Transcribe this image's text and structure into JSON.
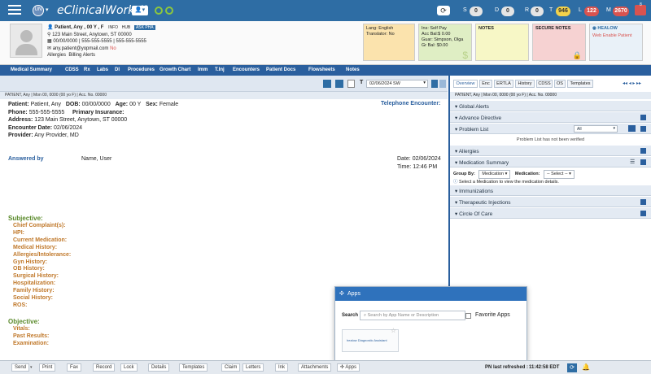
{
  "topbar": {
    "initials": "UN",
    "product": "eClinicalWorks",
    "version": "12",
    "counters": [
      {
        "letter": "S",
        "count": "0"
      },
      {
        "letter": "D",
        "count": "0"
      },
      {
        "letter": "R",
        "count": "0"
      },
      {
        "letter": "T",
        "count": "946"
      },
      {
        "letter": "L",
        "count": "122"
      },
      {
        "letter": "M",
        "count": "2670"
      }
    ],
    "corner_badge": "8"
  },
  "patient": {
    "name_line": "Patient, Any , 00 Y , F",
    "tags": [
      "INFO",
      "HUB",
      "ASK PHA"
    ],
    "address": "123 Main Street, Anytown, ST 00000",
    "dob_phone": "00/00/0000  |  555-555-5555  |  555-555-5555",
    "email": "any.patient@yopmail.com",
    "email_flag": "No",
    "allergies_link": "Allergies",
    "alerts_link": "Billing Alerts"
  },
  "cards": {
    "lang": [
      "Lang: English",
      "Translator: No"
    ],
    "ins": [
      "Ins: Self Pay",
      "Acc Bal:$ 0.00",
      "Guar: Simpson, Olga",
      "Gr Bal: $0.00"
    ],
    "notes": "NOTES",
    "secure_notes": "SECURE NOTES",
    "healow": "HEALOW",
    "healow_link": "Web Enable Patient"
  },
  "nav": [
    "Medical Summary",
    "CDSS",
    "Rx",
    "Labs",
    "DI",
    "Procedures",
    "Growth Chart",
    "Imm",
    "T.Inj",
    "Encounters",
    "Patient Docs",
    "Flowsheets",
    "Notes"
  ],
  "toolstrip": {
    "date": "02/06/2024 SW"
  },
  "ptline": "PATIENT, Any  |  Mon 00, 0000 (00 yo F)  |  Acc. No. 00000",
  "encounter": {
    "patient_lbl": "Patient:",
    "patient_val": "Patient, Any",
    "dob_lbl": "DOB:",
    "dob_val": "00/00/0000",
    "age_lbl": "Age:",
    "age_val": "00 Y",
    "sex_lbl": "Sex:",
    "sex_val": "Female",
    "phone_lbl": "Phone:",
    "phone_val": "555-555-5555",
    "ins_lbl": "Primary Insurance:",
    "addr_lbl": "Address:",
    "addr_val": "123 Main Street, Anytown, ST 00000",
    "encdate_lbl": "Encounter Date:",
    "encdate_val": "02/06/2024",
    "provider_lbl": "Provider:",
    "provider_val": "Any Provider, MD",
    "telephone": "Telephone Encounter:",
    "answered_by": "Answered by",
    "answered_name": "Name, User",
    "date_lbl": "Date:",
    "date_val": "02/06/2024",
    "time_lbl": "Time:",
    "time_val": "12:46 PM",
    "subjective": "Subjective:",
    "subj_items": [
      "Chief Complaint(s):",
      "HPI:",
      "Current Medication:",
      "Medical History:",
      "Allergies/Intolerance:",
      "Gyn History:",
      "OB History:",
      "Surgical History:",
      "Hospitalization:",
      "Family History:",
      "Social History:",
      "ROS:"
    ],
    "objective": "Objective:",
    "obj_items": [
      "Vitals:",
      "Past Results:",
      "Examination:"
    ]
  },
  "right": {
    "tabs": [
      "Overview",
      "Enc",
      "ERTLA",
      "History",
      "CDSS",
      "OS",
      "Templates"
    ],
    "ptline": "PATIENT, Any  |  Mon 00, 0000 (00 yo F)  |  Acc. No. 00000",
    "sections": {
      "global_alerts": "Global Alerts",
      "advance_directive": "Advance Directive",
      "problem_list": "Problem List",
      "problem_filter": "All",
      "problem_msg": "Problem List has not been verified",
      "allergies": "Allergies",
      "med_summary": "Medication Summary",
      "group_by_lbl": "Group By:",
      "group_by_val": "Medication",
      "medication_lbl": "Medication:",
      "medication_val": "-- Select --",
      "med_msg": "Select a Medication to view the medication details.",
      "immunizations": "Immunizations",
      "ther_inj": "Therapeutic Injections",
      "circle_care": "Circle Of Care"
    }
  },
  "apps": {
    "title": "Apps",
    "search_lbl": "Search",
    "search_placeholder": "Search by App Name or Description",
    "favorite": "Favorite Apps",
    "card_text": "healow Diagnostic Assistant"
  },
  "bottom": {
    "buttons": [
      "Send",
      "Print",
      "Fax",
      "Record",
      "Lock",
      "Details",
      "Templates",
      "Claim",
      "Letters",
      "Ink",
      "Attachments"
    ],
    "apps_btn": "Apps",
    "refreshed_lbl": "PN last refreshed :",
    "refreshed_time": "11:42:58 EDT"
  },
  "colors": {
    "primary": "#2e6da4",
    "nav": "#2a5f9e",
    "orange": "#c0782a",
    "green": "#5a8a2b"
  }
}
